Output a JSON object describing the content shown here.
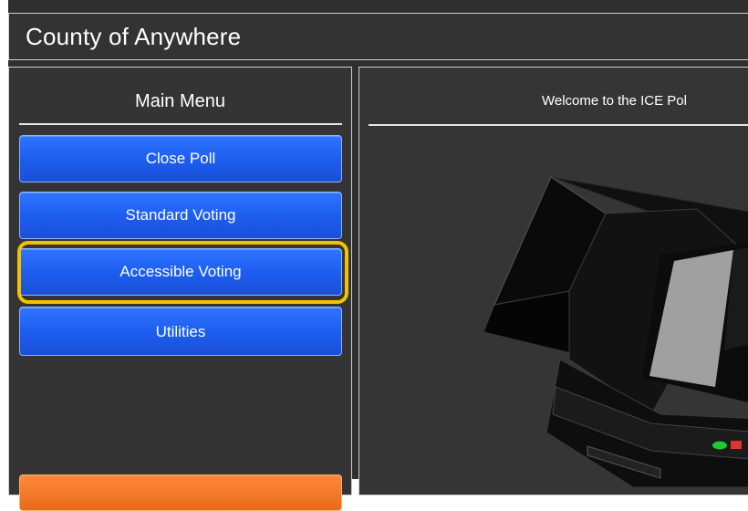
{
  "header": {
    "title": "County of Anywhere"
  },
  "menu": {
    "title": "Main Menu",
    "buttons": [
      {
        "label": "Close Poll"
      },
      {
        "label": "Standard Voting"
      },
      {
        "label": "Accessible Voting",
        "highlighted": true
      },
      {
        "label": "Utilities"
      }
    ]
  },
  "main": {
    "welcome": "Welcome to the ICE Pol"
  },
  "colors": {
    "button_blue": "#1d5ef0",
    "highlight": "#f2c200",
    "accent_orange": "#e86a1a",
    "background": "#2f2f2f"
  }
}
